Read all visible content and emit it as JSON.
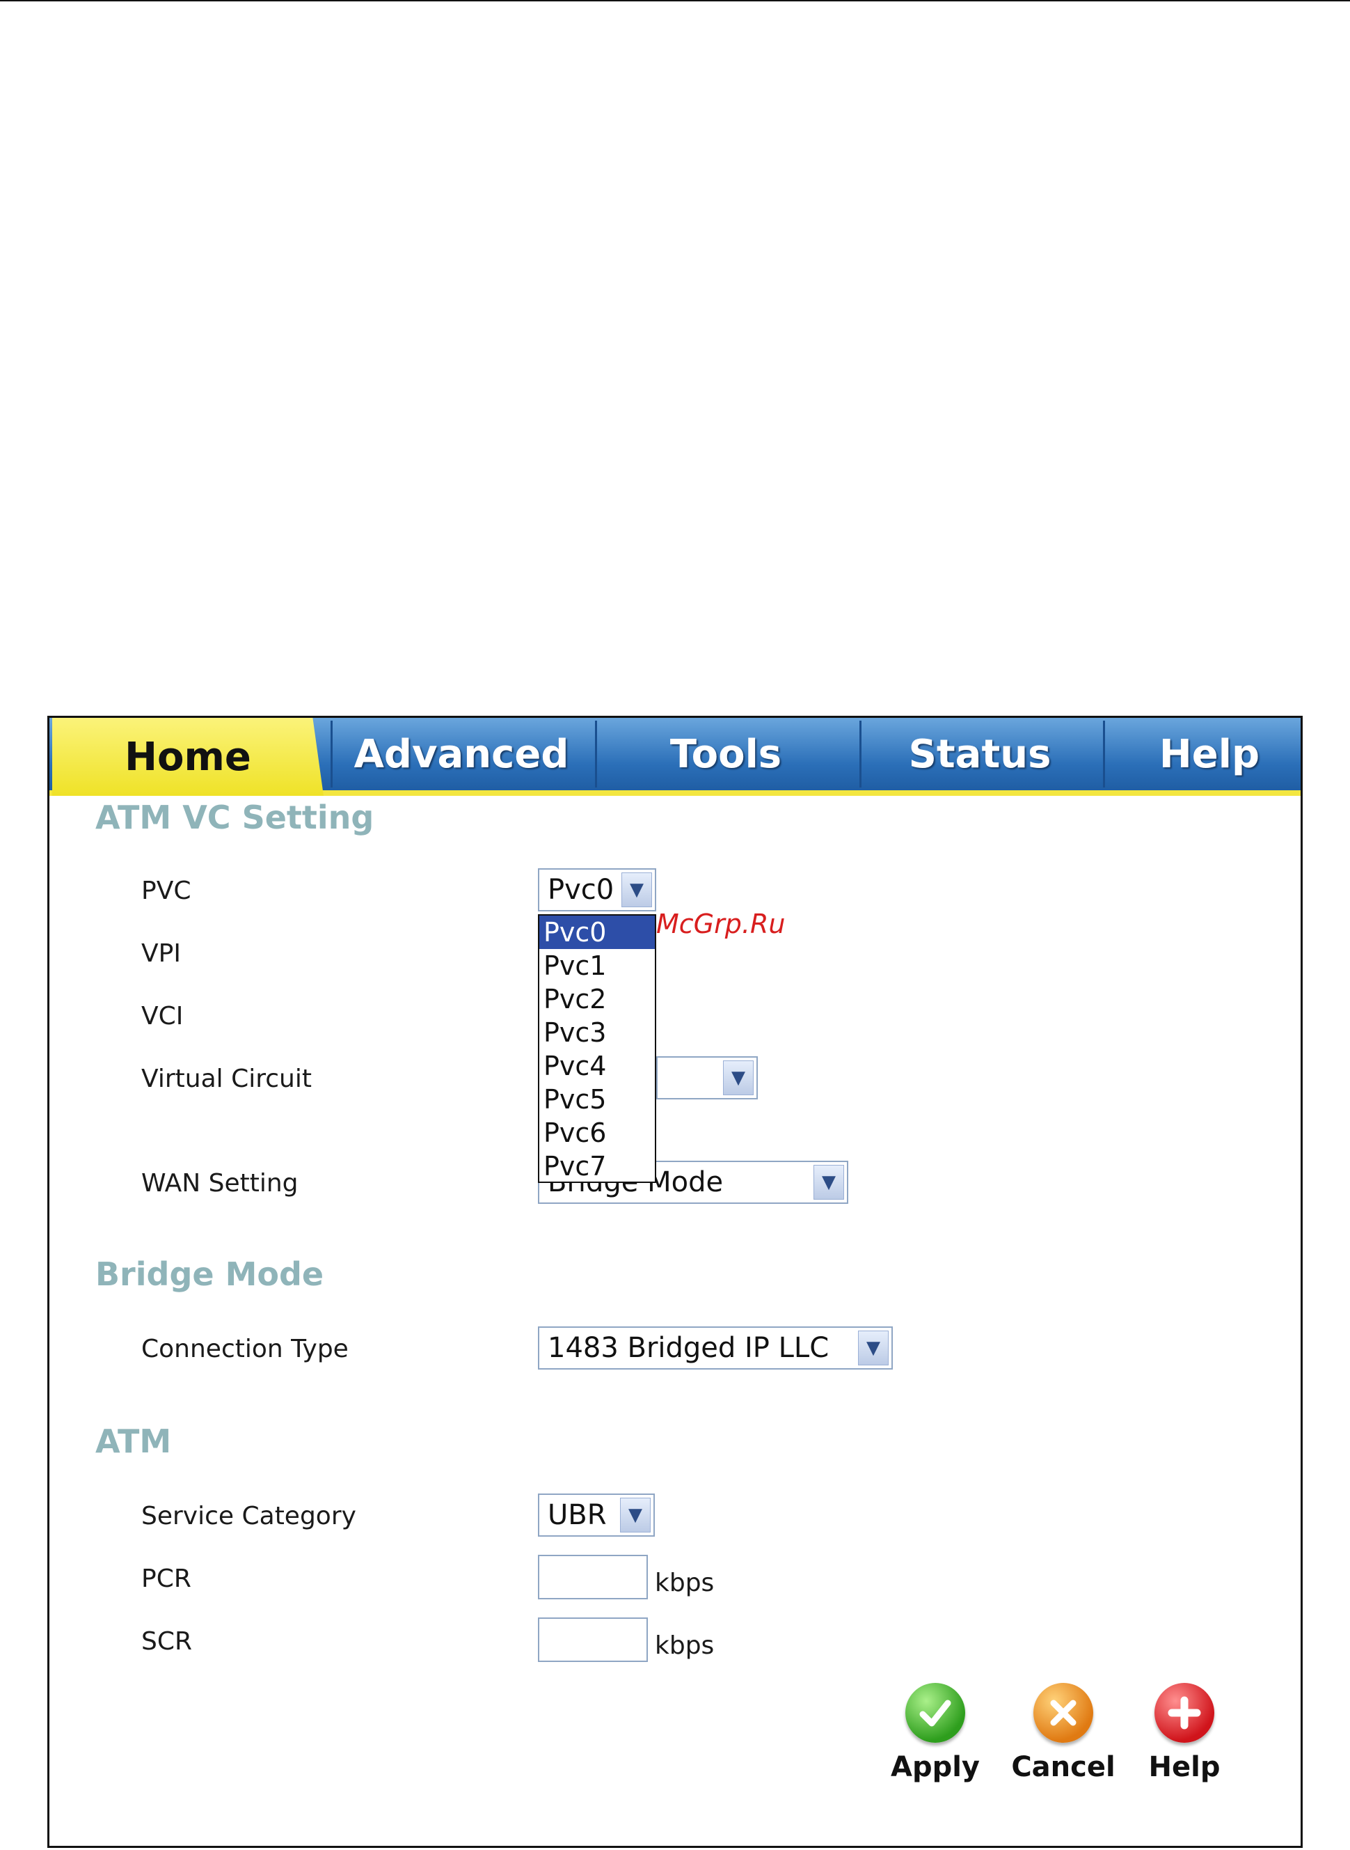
{
  "tabs": {
    "home": "Home",
    "advanced": "Advanced",
    "tools": "Tools",
    "status": "Status",
    "help": "Help"
  },
  "atm_vc": {
    "title": "ATM VC Setting",
    "pvc_label": "PVC",
    "pvc_value": "Pvc0",
    "vpi_label": "VPI",
    "vci_label": "VCI",
    "virtual_circuit_label": "Virtual Circuit",
    "wan_setting_label": "WAN Setting",
    "wan_setting_value": "Bridge Mode"
  },
  "pvc_dropdown": {
    "options": [
      "Pvc0",
      "Pvc1",
      "Pvc2",
      "Pvc3",
      "Pvc4",
      "Pvc5",
      "Pvc6",
      "Pvc7"
    ],
    "selected_index": 0
  },
  "watermark": "McGrp.Ru",
  "bridge": {
    "title": "Bridge Mode",
    "connection_type_label": "Connection Type",
    "connection_type_value": "1483 Bridged IP LLC"
  },
  "atm": {
    "title": "ATM",
    "service_category_label": "Service Category",
    "service_category_value": "UBR",
    "pcr_label": "PCR",
    "pcr_value": "",
    "pcr_unit": "kbps",
    "scr_label": "SCR",
    "scr_value": "",
    "scr_unit": "kbps"
  },
  "actions": {
    "apply": "Apply",
    "cancel": "Cancel",
    "help": "Help"
  },
  "icons": {
    "apply": "check-icon",
    "cancel": "x-icon",
    "help": "plus-icon",
    "dropdown": "chevron-down-icon"
  }
}
